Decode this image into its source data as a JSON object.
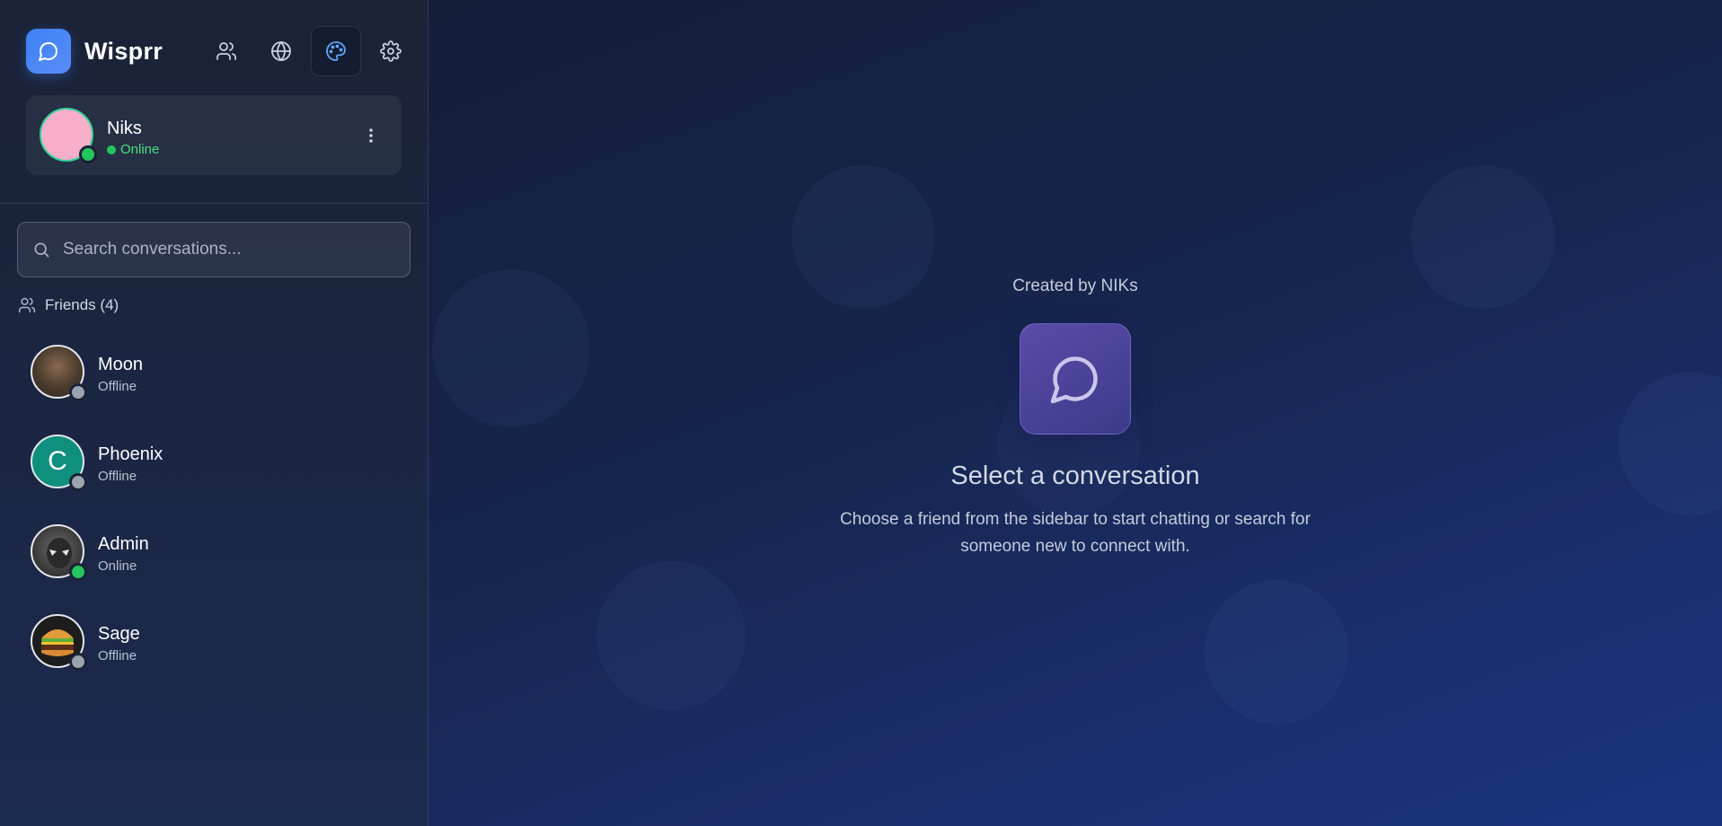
{
  "app": {
    "name": "Wisprr"
  },
  "nav": {
    "icons": [
      "users-icon",
      "globe-icon",
      "palette-icon",
      "settings-icon"
    ],
    "active": "palette-icon"
  },
  "profile": {
    "name": "Niks",
    "status": "Online"
  },
  "search": {
    "placeholder": "Search conversations..."
  },
  "friends": {
    "header": "Friends (4)",
    "items": [
      {
        "name": "Moon",
        "status": "Offline",
        "avatar": "photo"
      },
      {
        "name": "Phoenix",
        "status": "Offline",
        "avatar_letter": "C"
      },
      {
        "name": "Admin",
        "status": "Online",
        "avatar": "photo"
      },
      {
        "name": "Sage",
        "status": "Offline",
        "avatar": "burger"
      }
    ]
  },
  "main": {
    "created_by": "Created by NIKs",
    "title": "Select a conversation",
    "subtitle": "Choose a friend from the sidebar to start chatting or search for someone new to connect with."
  },
  "colors": {
    "accent": "#3b82f6",
    "online": "#22c55e",
    "offline": "#9ca3af",
    "sidebar_bg": "#1a2236",
    "main_bg": "#16244a"
  }
}
